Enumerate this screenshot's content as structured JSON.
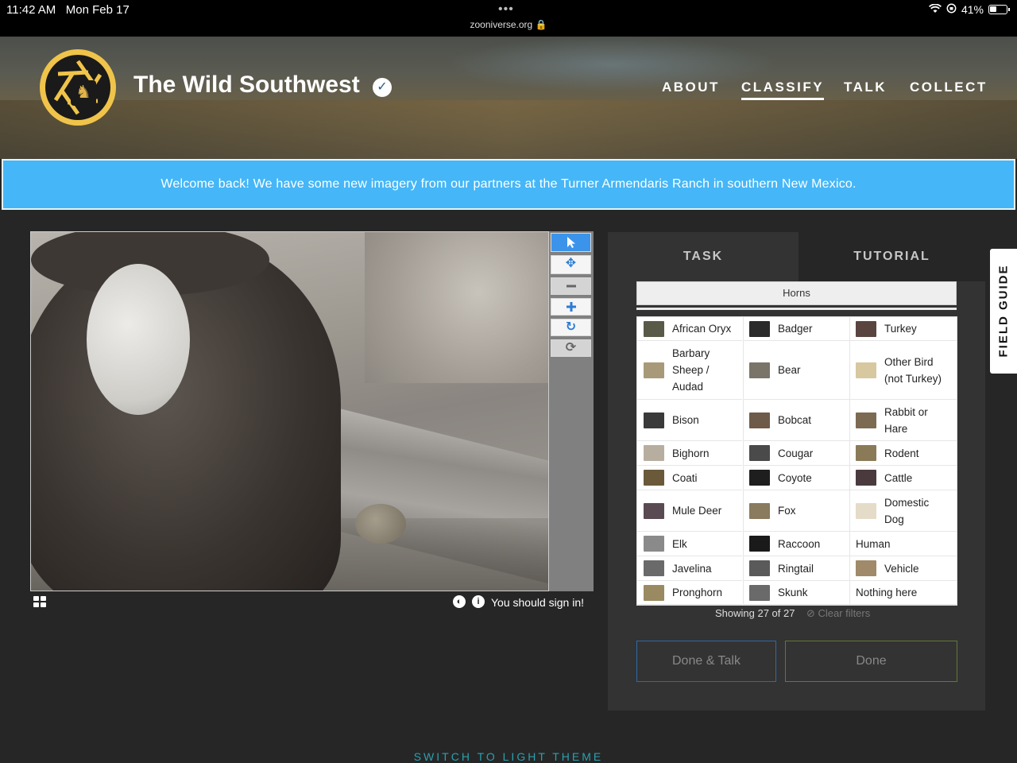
{
  "statusbar": {
    "time": "11:42 AM",
    "date": "Mon Feb 17",
    "dots": "•••",
    "url": "zooniverse.org 🔒",
    "battery": "41%"
  },
  "header": {
    "title": "The Wild Southwest",
    "nav": [
      {
        "label": "ABOUT"
      },
      {
        "label": "CLASSIFY",
        "active": true
      },
      {
        "label": "TALK"
      },
      {
        "label": "COLLECT"
      }
    ]
  },
  "announcement": "Welcome back! We have some new imagery from our partners at the Turner Armendaris Ranch in southern New Mexico.",
  "viewer": {
    "toolbar_icons": [
      "pointer-icon",
      "move-icon",
      "zoom-out-icon",
      "zoom-in-icon",
      "rotate-icon",
      "reset-icon"
    ],
    "sign_in_text": "You should sign in!"
  },
  "task": {
    "tabs": [
      "TASK",
      "TUTORIAL"
    ],
    "filter_label": "Horns",
    "choices": [
      {
        "label": "African Oryx",
        "color": "#5a5a48"
      },
      {
        "label": "Badger",
        "color": "#2a2a2a"
      },
      {
        "label": "Turkey",
        "color": "#5a4440"
      },
      {
        "label": "Barbary Sheep / Audad",
        "color": "#a89a78"
      },
      {
        "label": "Bear",
        "color": "#7a7468"
      },
      {
        "label": "Other Bird (not Turkey)",
        "color": "#d8c8a0"
      },
      {
        "label": "Bison",
        "color": "#3a3a3a"
      },
      {
        "label": "Bobcat",
        "color": "#6e5a48"
      },
      {
        "label": "Rabbit or Hare",
        "color": "#7c6a52"
      },
      {
        "label": "Bighorn",
        "color": "#b8aea0"
      },
      {
        "label": "Cougar",
        "color": "#4a4a4a"
      },
      {
        "label": "Rodent",
        "color": "#8a7a58"
      },
      {
        "label": "Coati",
        "color": "#6a5a3a"
      },
      {
        "label": "Coyote",
        "color": "#1e1e1e"
      },
      {
        "label": "Cattle",
        "color": "#4a3a3e"
      },
      {
        "label": "Mule Deer",
        "color": "#5a4a52"
      },
      {
        "label": "Fox",
        "color": "#8a7a5e"
      },
      {
        "label": "Domestic Dog",
        "color": "#e4dcc8"
      },
      {
        "label": "Elk",
        "color": "#8a8a8a"
      },
      {
        "label": "Raccoon",
        "color": "#1a1a1a"
      },
      {
        "label": "Human",
        "color": ""
      },
      {
        "label": "Javelina",
        "color": "#6a6a6a"
      },
      {
        "label": "Ringtail",
        "color": "#5a5a5a"
      },
      {
        "label": "Vehicle",
        "color": "#a08a6a"
      },
      {
        "label": "Pronghorn",
        "color": "#9a8a62"
      },
      {
        "label": "Skunk",
        "color": "#6a6a6a"
      },
      {
        "label": "Nothing here",
        "color": ""
      }
    ],
    "showing": "Showing 27 of 27",
    "clear_filters": "⊘ Clear filters",
    "done_talk": "Done & Talk",
    "done": "Done"
  },
  "field_guide": "FIELD GUIDE",
  "switch_theme": "SWITCH TO LIGHT THEME"
}
